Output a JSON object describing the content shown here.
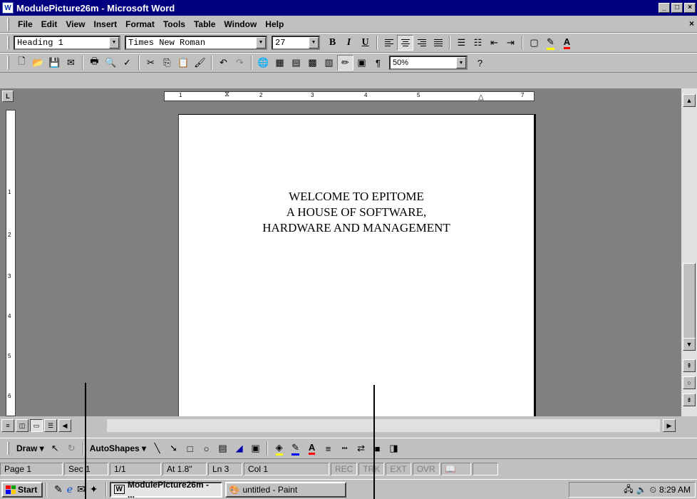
{
  "window": {
    "title": "ModulePicture26m - Microsoft Word",
    "controls": [
      "_",
      "□",
      "×"
    ]
  },
  "menu": {
    "items": [
      {
        "accel": "F",
        "rest": "ile"
      },
      {
        "accel": "E",
        "rest": "dit"
      },
      {
        "accel": "V",
        "rest": "iew"
      },
      {
        "accel": "I",
        "rest": "nsert"
      },
      {
        "accel": "",
        "rest": "Format",
        "mid_accel": "o"
      },
      {
        "accel": "T",
        "rest": "ools"
      },
      {
        "accel": "",
        "rest": "Table"
      },
      {
        "accel": "W",
        "rest": "indow"
      },
      {
        "accel": "H",
        "rest": "elp"
      }
    ],
    "labels": [
      "File",
      "Edit",
      "View",
      "Insert",
      "Format",
      "Tools",
      "Table",
      "Window",
      "Help"
    ],
    "close": "×"
  },
  "formatting": {
    "style": "Heading 1",
    "font": "Times New Roman",
    "size": "27"
  },
  "standard": {
    "zoom": "50%"
  },
  "ruler": {
    "numbers": [
      "1",
      "2",
      "3",
      "4",
      "5",
      "7"
    ]
  },
  "vruler": {
    "numbers": [
      "1",
      "2",
      "3",
      "4",
      "5",
      "6"
    ]
  },
  "document": {
    "lines": [
      "WELCOME TO EPITOME",
      "A HOUSE OF SOFTWARE,",
      "HARDWARE AND MANAGEMENT"
    ]
  },
  "drawing": {
    "draw": "Draw",
    "autoshapes": "AutoShapes"
  },
  "status": {
    "page": "Page 1",
    "sec": "Sec 1",
    "pages": "1/1",
    "at": "At 1.8\"",
    "ln": "Ln 3",
    "col": "Col 1",
    "rec": "REC",
    "trk": "TRK",
    "ext": "EXT",
    "ovr": "OVR"
  },
  "taskbar": {
    "start": "Start",
    "task1": "ModulePicture26m - ...",
    "task2": "untitled - Paint",
    "time": "8:29 AM"
  }
}
